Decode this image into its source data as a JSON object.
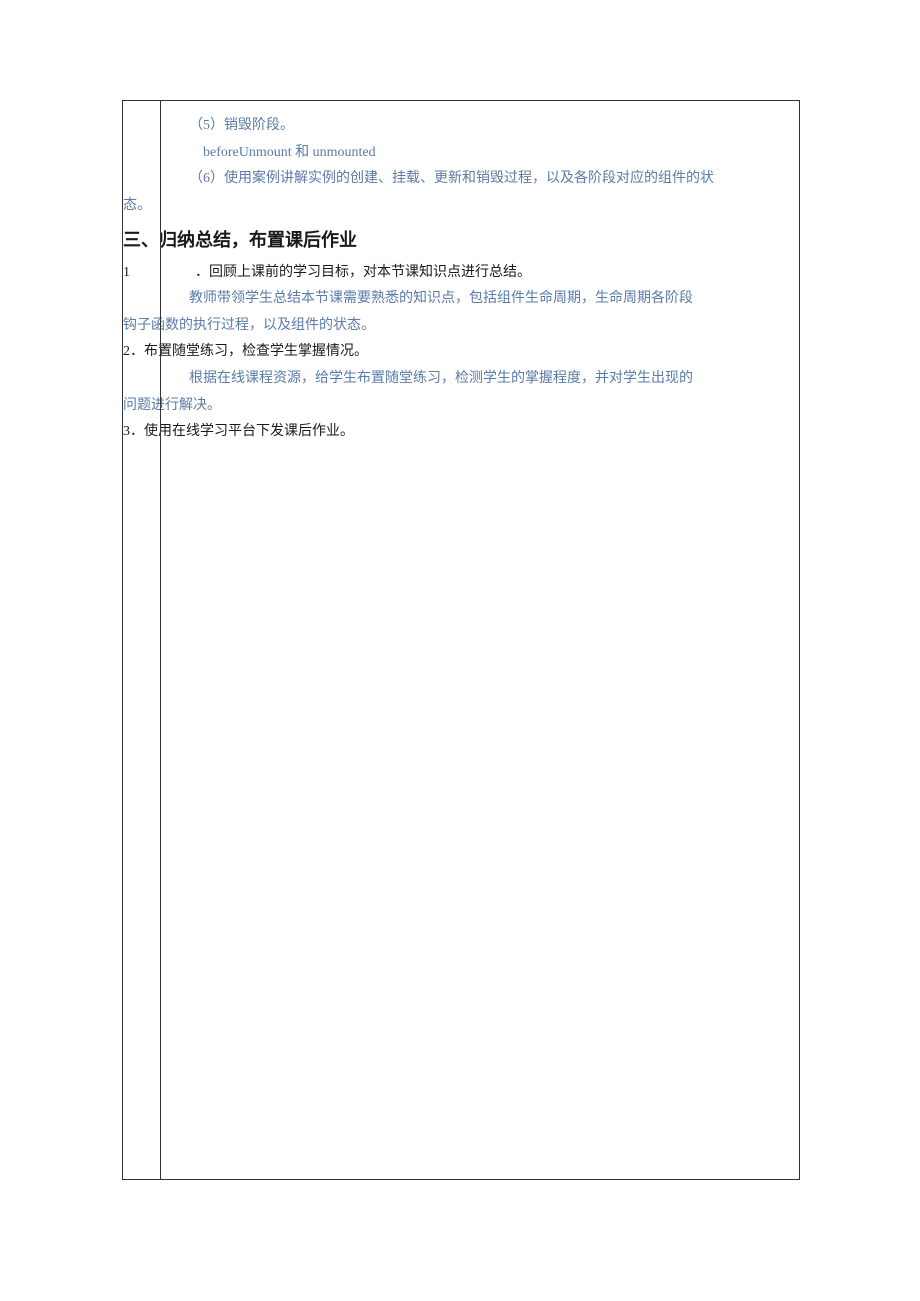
{
  "lines": {
    "l1": "（5）销毁阶段。",
    "l2": "beforeUnmount 和 unmounted",
    "l3": "（6）使用案例讲解实例的创建、挂载、更新和销毁过程，以及各阶段对应的组件的状",
    "l4": "态。",
    "heading": "三、归纳总结，布置课后作业",
    "item1_num": "1",
    "item1_text": "．回顾上课前的学习目标，对本节课知识点进行总结。",
    "item1_body1": "教师带领学生总结本节课需要熟悉的知识点，包括组件生命周期，生命周期各阶段",
    "item1_body2": "钩子函数的执行过程，以及组件的状态。",
    "item2_head": "2．布置随堂练习，检查学生掌握情况。",
    "item2_body1": "根据在线课程资源，给学生布置随堂练习，检测学生的掌握程度，并对学生出现的",
    "item2_body2": "问题进行解决。",
    "item3_head": "3．使用在线学习平台下发课后作业。"
  }
}
